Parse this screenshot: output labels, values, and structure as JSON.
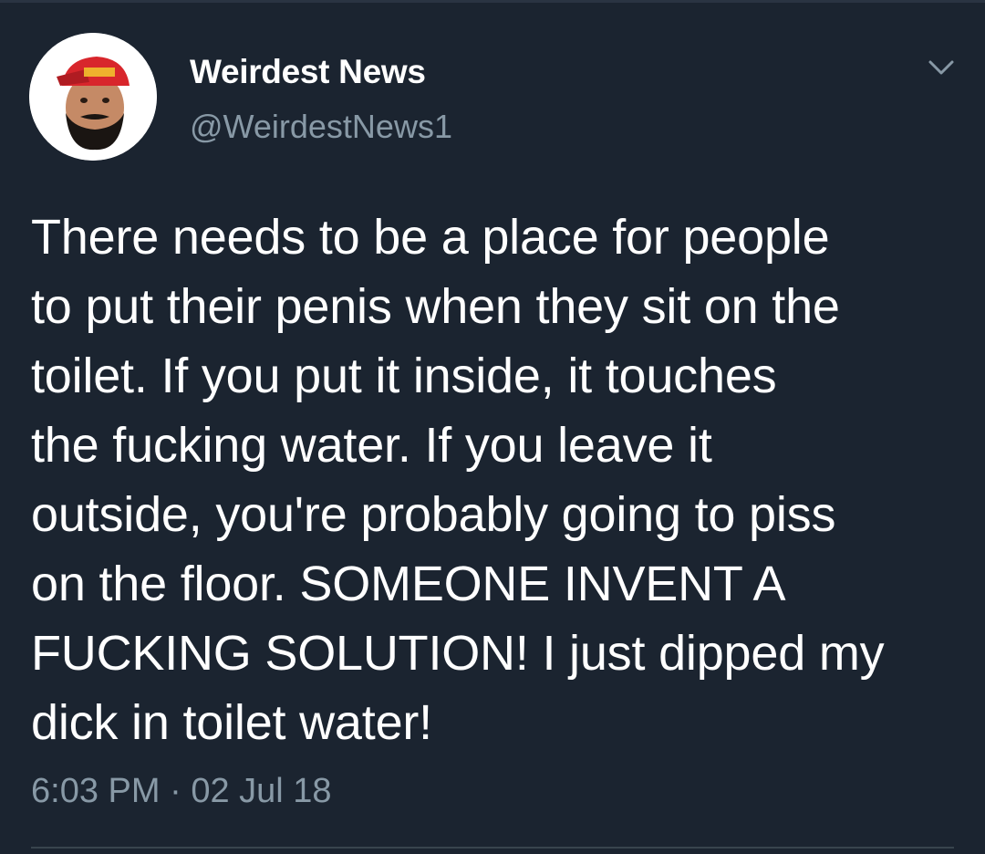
{
  "tweet": {
    "display_name": "Weirdest News",
    "handle": "@WeirdestNews1",
    "text_lines": [
      "There needs to be a place for people",
      "to put their penis when they sit on the",
      "toilet. If you put it inside, it touches",
      "the fucking water. If you leave it",
      "outside, you're probably going to piss",
      "on the floor. SOMEONE INVENT A",
      "FUCKING SOLUTION! I just dipped my",
      "dick in toilet water!"
    ],
    "time": "6:03 PM",
    "separator": "·",
    "date": "02 Jul 18",
    "menu_icon": "chevron-down-icon",
    "avatar_icon": "profile-avatar"
  },
  "colors": {
    "background": "#1b2430",
    "text_primary": "#ffffff",
    "text_secondary": "#8899a6",
    "divider": "#38444d"
  }
}
